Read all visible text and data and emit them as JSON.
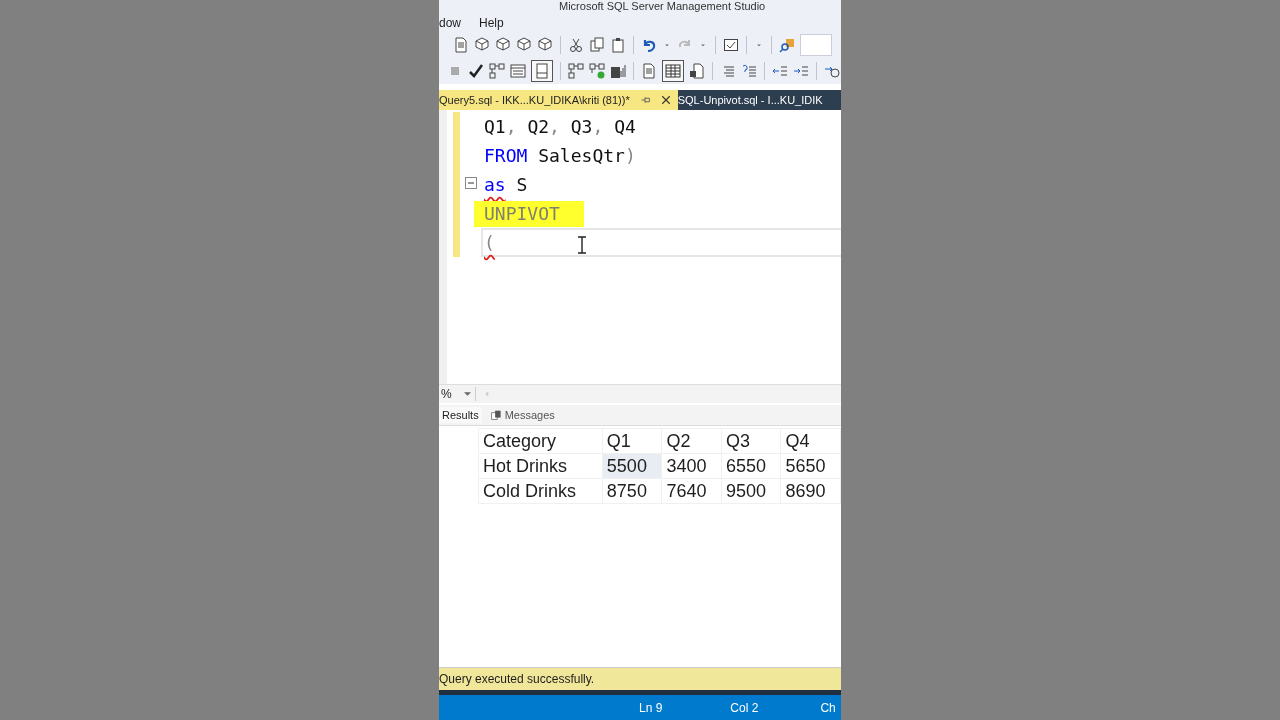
{
  "window": {
    "title": "Microsoft SQL Server Management Studio"
  },
  "menu": [
    {
      "label": "dow"
    },
    {
      "label": "Help"
    }
  ],
  "tabs": [
    {
      "label": "Query5.sql - IKK...KU_IDIKA\\kriti (81))*",
      "selected": true
    },
    {
      "label": "SQL-Unpivot.sql - I...KU_IDIK",
      "selected": false
    }
  ],
  "editor": {
    "lines": [
      {
        "fold": false,
        "highlighted": false,
        "current": false,
        "tokens": [
          {
            "text": "Q1",
            "kind": "ident",
            "error": false
          },
          {
            "text": ", ",
            "kind": "punct",
            "error": false
          },
          {
            "text": "Q2",
            "kind": "ident",
            "error": false
          },
          {
            "text": ", ",
            "kind": "punct",
            "error": false
          },
          {
            "text": "Q3",
            "kind": "ident",
            "error": false
          },
          {
            "text": ", ",
            "kind": "punct",
            "error": false
          },
          {
            "text": "Q4",
            "kind": "ident",
            "error": false
          }
        ]
      },
      {
        "fold": false,
        "highlighted": false,
        "current": false,
        "tokens": [
          {
            "text": "FROM",
            "kind": "keyword",
            "error": false
          },
          {
            "text": " SalesQtr",
            "kind": "ident",
            "error": false
          },
          {
            "text": ")",
            "kind": "punct",
            "error": false
          }
        ]
      },
      {
        "fold": true,
        "highlighted": false,
        "current": false,
        "tokens": [
          {
            "text": "as",
            "kind": "keyword",
            "error": true
          },
          {
            "text": " S",
            "kind": "ident",
            "error": false
          }
        ]
      },
      {
        "fold": false,
        "highlighted": true,
        "current": false,
        "tokens": [
          {
            "text": "UNPIVOT",
            "kind": "unknown",
            "error": false
          }
        ]
      },
      {
        "fold": false,
        "highlighted": false,
        "current": true,
        "tokens": [
          {
            "text": "(",
            "kind": "punct",
            "error": true
          }
        ]
      }
    ]
  },
  "zoom": {
    "value": "%"
  },
  "results_tabs": [
    {
      "label": "Results",
      "selected": true
    },
    {
      "label": "Messages",
      "selected": false
    }
  ],
  "grid": {
    "columns": [
      "Category",
      "Q1",
      "Q2",
      "Q3",
      "Q4"
    ],
    "rows": [
      {
        "cells": [
          {
            "text": "Hot Drinks",
            "selected": false
          },
          {
            "text": "5500",
            "selected": true
          },
          {
            "text": "3400",
            "selected": false
          },
          {
            "text": "6550",
            "selected": false
          },
          {
            "text": "5650",
            "selected": false
          }
        ]
      },
      {
        "cells": [
          {
            "text": "Cold Drinks",
            "selected": false
          },
          {
            "text": "8750",
            "selected": false
          },
          {
            "text": "7640",
            "selected": false
          },
          {
            "text": "9500",
            "selected": false
          },
          {
            "text": "8690",
            "selected": false
          }
        ]
      }
    ]
  },
  "status": {
    "message": "Query executed successfully."
  },
  "status_bar": [
    "Ln 9",
    "Col 2",
    "Ch"
  ]
}
